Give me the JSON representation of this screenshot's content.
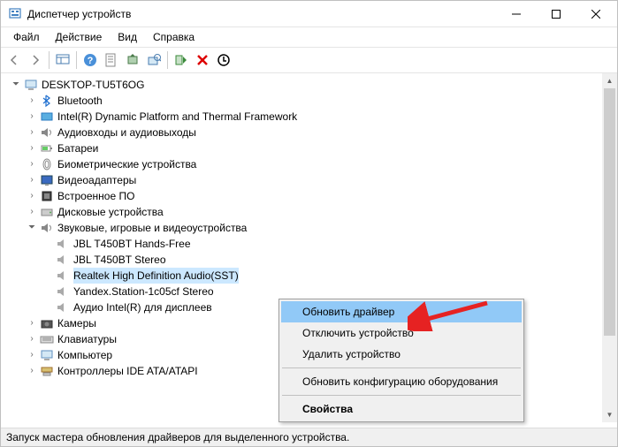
{
  "title": "Диспетчер устройств",
  "menu": {
    "file": "Файл",
    "action": "Действие",
    "view": "Вид",
    "help": "Справка"
  },
  "tree": {
    "root": "DESKTOP-TU5T6OG",
    "categories": [
      "Bluetooth",
      "Intel(R) Dynamic Platform and Thermal Framework",
      "Аудиовходы и аудиовыходы",
      "Батареи",
      "Биометрические устройства",
      "Видеоадаптеры",
      "Встроенное ПО",
      "Дисковые устройства",
      "Звуковые, игровые и видеоустройства",
      "Камеры",
      "Клавиатуры",
      "Компьютер",
      "Контроллеры IDE ATA/ATAPI"
    ],
    "sounddevs": [
      "JBL T450BT Hands-Free",
      "JBL T450BT Stereo",
      "Realtek High Definition Audio(SST)",
      "Yandex.Station-1c05cf Stereo",
      "Аудио Intel(R) для дисплеев"
    ]
  },
  "context": {
    "update_driver": "Обновить драйвер",
    "disable_device": "Отключить устройство",
    "uninstall_device": "Удалить устройство",
    "scan_hardware": "Обновить конфигурацию оборудования",
    "properties": "Свойства"
  },
  "statusbar": "Запуск мастера обновления драйверов для выделенного устройства."
}
